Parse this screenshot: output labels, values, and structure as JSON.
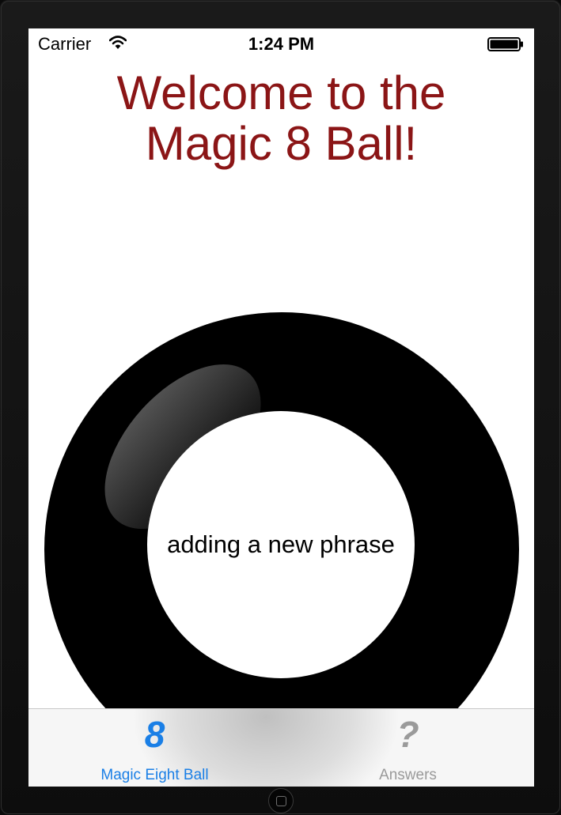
{
  "status_bar": {
    "carrier": "Carrier",
    "time": "1:24 PM",
    "wifi_icon": "wifi-icon",
    "battery_icon": "battery-icon"
  },
  "title": {
    "line1": "Welcome to the",
    "line2": "Magic 8 Ball!"
  },
  "ball": {
    "answer": "adding a new phrase"
  },
  "tab_bar": {
    "tabs": [
      {
        "label": "Magic Eight Ball",
        "icon_glyph": "8",
        "icon": "eight-icon",
        "active": true
      },
      {
        "label": "Answers",
        "icon_glyph": "?",
        "icon": "question-mark-icon",
        "active": false
      }
    ]
  },
  "colors": {
    "title": "#8b1516",
    "tab_active": "#1a7fe6",
    "tab_inactive": "#9a9a9a"
  }
}
